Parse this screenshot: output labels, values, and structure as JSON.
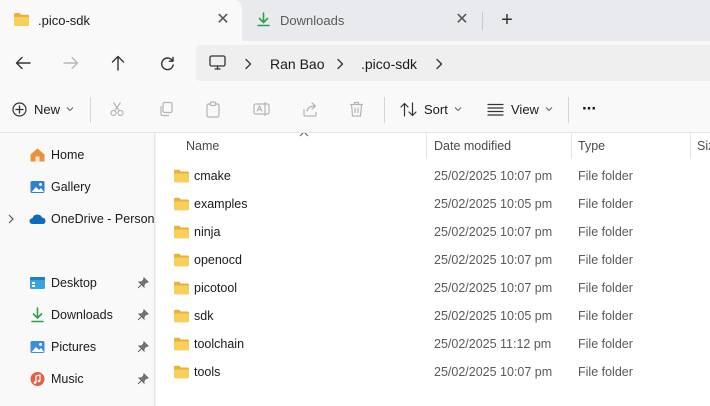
{
  "tabs": [
    {
      "label": ".pico-sdk",
      "icon": "folder-icon",
      "active": true
    },
    {
      "label": "Downloads",
      "icon": "download-icon",
      "active": false
    }
  ],
  "address": {
    "crumbs": [
      "Ran Bao",
      ".pico-sdk"
    ]
  },
  "commands": {
    "new_label": "New",
    "sort_label": "Sort",
    "view_label": "View",
    "more_label": "···"
  },
  "nav": {
    "items": [
      {
        "label": "Home",
        "icon": "home-icon"
      },
      {
        "label": "Gallery",
        "icon": "gallery-icon"
      },
      {
        "label": "OneDrive - Personal",
        "icon": "onedrive-icon"
      },
      {
        "label": "Desktop",
        "icon": "desktop-icon"
      },
      {
        "label": "Downloads",
        "icon": "download-icon"
      },
      {
        "label": "Pictures",
        "icon": "pictures-icon"
      },
      {
        "label": "Music",
        "icon": "music-icon"
      }
    ]
  },
  "columns": {
    "name": "Name",
    "date": "Date modified",
    "type": "Type",
    "size": "Size"
  },
  "files": [
    {
      "name": "cmake",
      "date": "25/02/2025 10:07 pm",
      "type": "File folder"
    },
    {
      "name": "examples",
      "date": "25/02/2025 10:05 pm",
      "type": "File folder"
    },
    {
      "name": "ninja",
      "date": "25/02/2025 10:07 pm",
      "type": "File folder"
    },
    {
      "name": "openocd",
      "date": "25/02/2025 10:07 pm",
      "type": "File folder"
    },
    {
      "name": "picotool",
      "date": "25/02/2025 10:07 pm",
      "type": "File folder"
    },
    {
      "name": "sdk",
      "date": "25/02/2025 10:05 pm",
      "type": "File folder"
    },
    {
      "name": "toolchain",
      "date": "25/02/2025 11:12 pm",
      "type": "File folder"
    },
    {
      "name": "tools",
      "date": "25/02/2025 10:07 pm",
      "type": "File folder"
    }
  ],
  "colors": {
    "folder": "#f5c542",
    "accent": "#0067c0",
    "download_green": "#2aa14a"
  }
}
